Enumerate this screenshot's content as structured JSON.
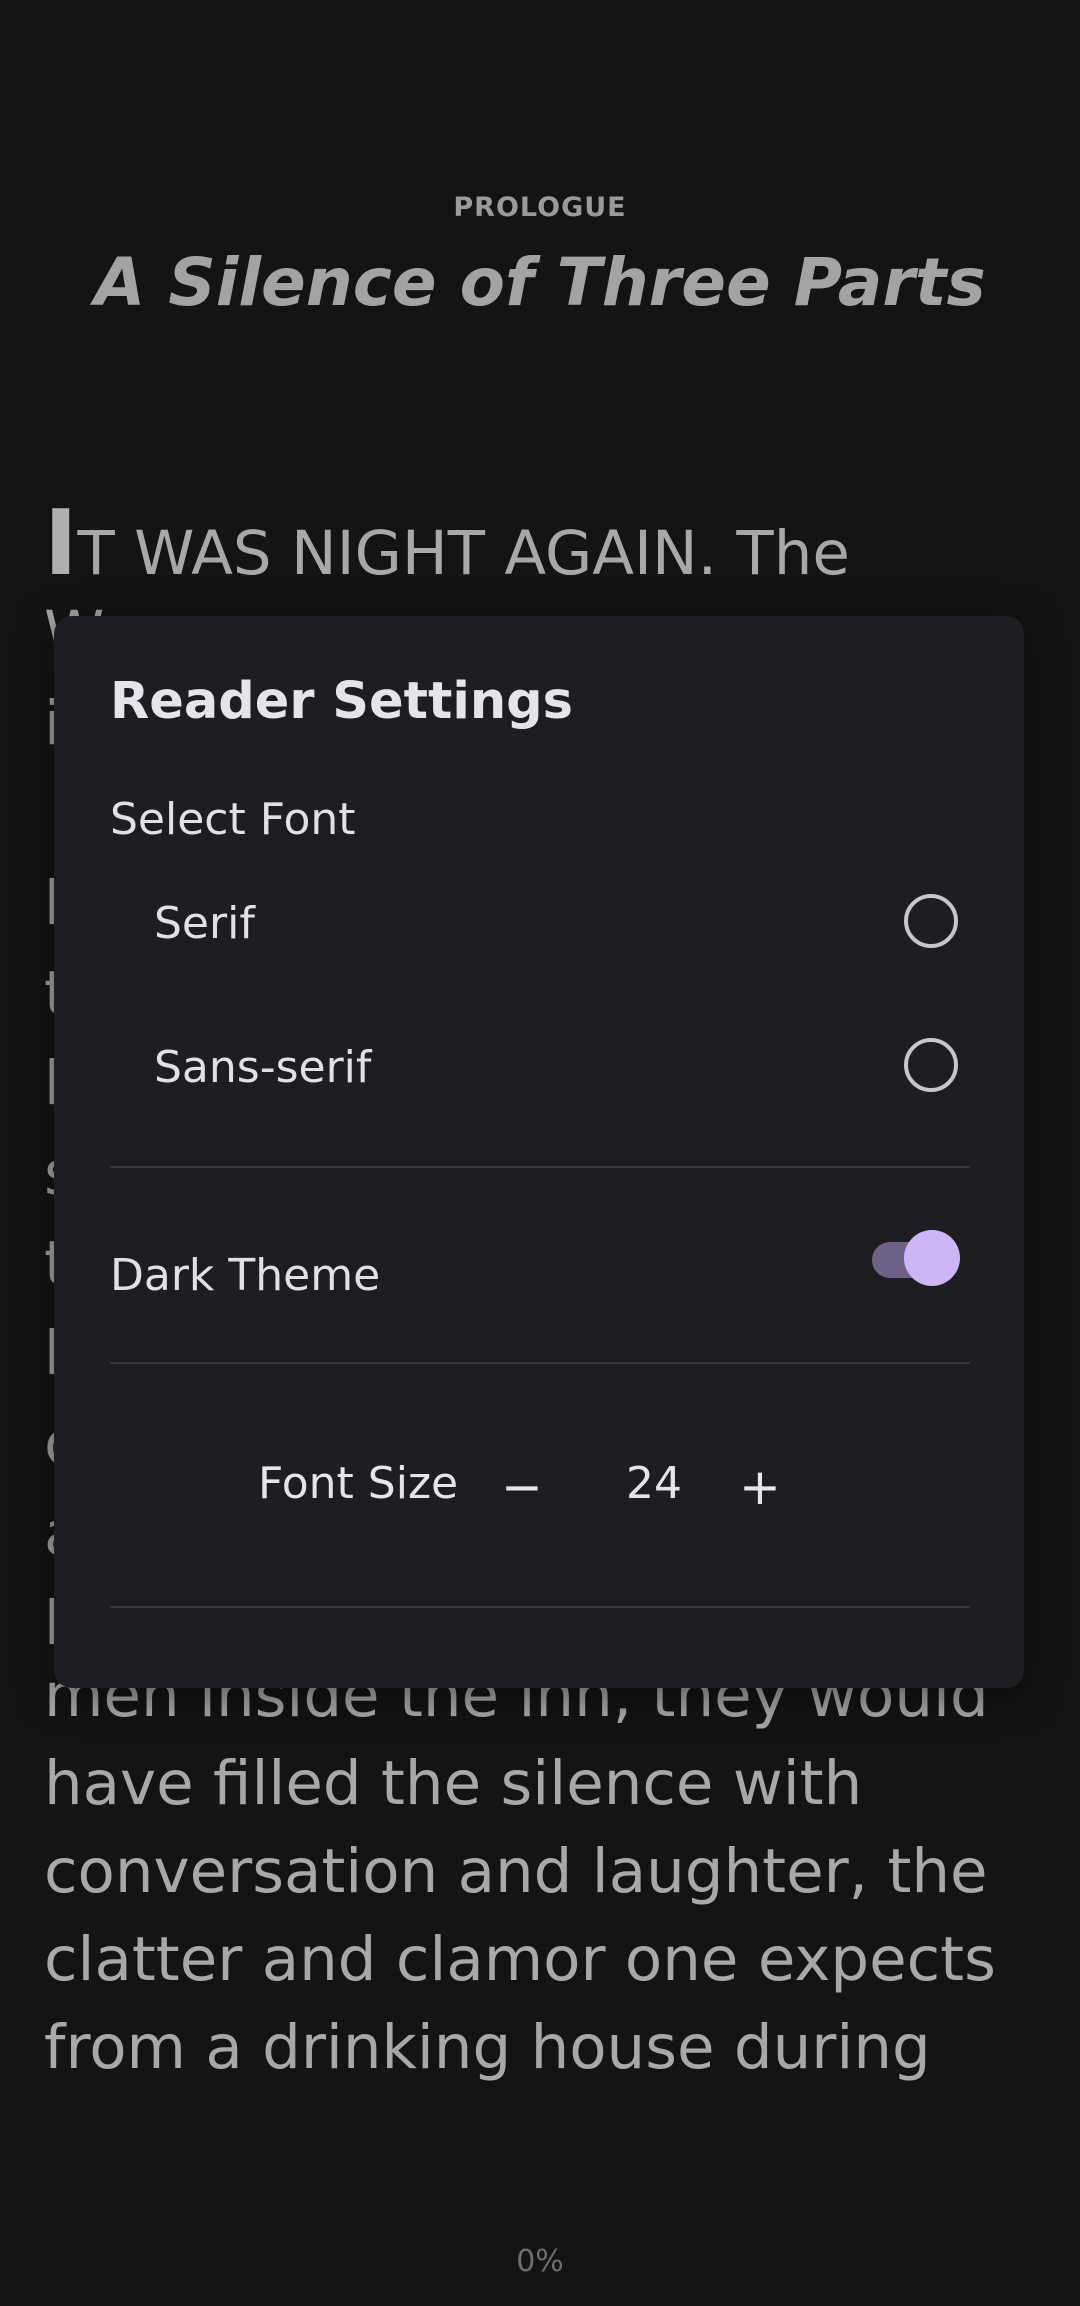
{
  "chapter": {
    "label": "PROLOGUE",
    "title": "A Silence of Three Parts"
  },
  "body": {
    "dropcap": "I",
    "first_line_rest": "T WAS NIGHT AGAIN. The",
    "line_2": "men inside the inn, they would",
    "line_3": "have filled the silence with",
    "line_4": "conversation and laughter, the",
    "line_5": "clatter and clamor one expects",
    "line_6": "from a drinking house during",
    "obscured_left_glyphs": [
      "W",
      "i",
      "h",
      "t",
      "h",
      "s",
      "t",
      "h",
      "c",
      "a",
      "k"
    ]
  },
  "progress": "0%",
  "dialog": {
    "title": "Reader Settings",
    "font_section_label": "Select Font",
    "font_options": [
      {
        "label": "Serif",
        "selected": false
      },
      {
        "label": "Sans-serif",
        "selected": false
      }
    ],
    "theme_label": "Dark Theme",
    "theme_enabled": true,
    "font_size_label": "Font Size",
    "font_size_value": "24",
    "decrement_label": "−",
    "increment_label": "+"
  },
  "colors": {
    "background": "#141416",
    "dialog_bg": "#1e1d22",
    "accent": "#cdb5f6",
    "toggle_track": "#6e6287"
  }
}
